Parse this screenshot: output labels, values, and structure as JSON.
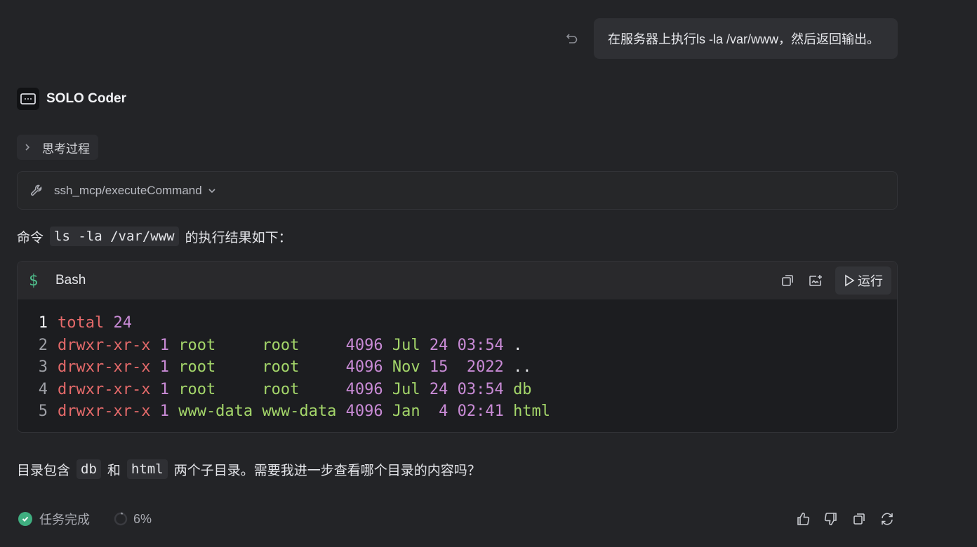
{
  "user_message": {
    "text": "在服务器上执行ls -la /var/www，然后返回输出。",
    "undo_icon": "undo-icon"
  },
  "agent": {
    "name": "SOLO Coder",
    "logo_icon": "terminal-chat-icon"
  },
  "thinking": {
    "label": "思考过程"
  },
  "tool_call": {
    "label": "ssh_mcp/executeCommand"
  },
  "intro": {
    "before": "命令",
    "code": "ls -la /var/www",
    "after": "的执行结果如下："
  },
  "code_block": {
    "language": "Bash",
    "run_label": "运行",
    "lines": [
      {
        "n": "1",
        "tokens": [
          {
            "t": "total ",
            "c": "tok-perm"
          },
          {
            "t": "24",
            "c": "tok-num"
          }
        ]
      },
      {
        "n": "2",
        "tokens": [
          {
            "t": "drwxr-xr-x ",
            "c": "tok-perm"
          },
          {
            "t": "1 ",
            "c": "tok-num"
          },
          {
            "t": "root     root     ",
            "c": "tok-word"
          },
          {
            "t": "4096 ",
            "c": "tok-num"
          },
          {
            "t": "Jul ",
            "c": "tok-word"
          },
          {
            "t": "24 03:54 ",
            "c": "tok-num"
          },
          {
            "t": ".",
            "c": "tok-plain"
          }
        ]
      },
      {
        "n": "3",
        "tokens": [
          {
            "t": "drwxr-xr-x ",
            "c": "tok-perm"
          },
          {
            "t": "1 ",
            "c": "tok-num"
          },
          {
            "t": "root     root     ",
            "c": "tok-word"
          },
          {
            "t": "4096 ",
            "c": "tok-num"
          },
          {
            "t": "Nov ",
            "c": "tok-word"
          },
          {
            "t": "15  2022 ",
            "c": "tok-num"
          },
          {
            "t": "..",
            "c": "tok-plain"
          }
        ]
      },
      {
        "n": "4",
        "tokens": [
          {
            "t": "drwxr-xr-x ",
            "c": "tok-perm"
          },
          {
            "t": "1 ",
            "c": "tok-num"
          },
          {
            "t": "root     root     ",
            "c": "tok-word"
          },
          {
            "t": "4096 ",
            "c": "tok-num"
          },
          {
            "t": "Jul ",
            "c": "tok-word"
          },
          {
            "t": "24 03:54 ",
            "c": "tok-num"
          },
          {
            "t": "db",
            "c": "tok-word"
          }
        ]
      },
      {
        "n": "5",
        "tokens": [
          {
            "t": "drwxr-xr-x ",
            "c": "tok-perm"
          },
          {
            "t": "1 ",
            "c": "tok-num"
          },
          {
            "t": "www-data www-data ",
            "c": "tok-word"
          },
          {
            "t": "4096 ",
            "c": "tok-num"
          },
          {
            "t": "Jan  ",
            "c": "tok-word"
          },
          {
            "t": "4 02:41 ",
            "c": "tok-num"
          },
          {
            "t": "html",
            "c": "tok-word"
          }
        ]
      }
    ]
  },
  "summary": {
    "part1": "目录包含",
    "code1": "db",
    "part2": "和",
    "code2": "html",
    "part3": "两个子目录。需要我进一步查看哪个目录的内容吗？"
  },
  "footer": {
    "status": "任务完成",
    "progress": "6%"
  },
  "colors": {
    "background": "#232427",
    "accent_green": "#3fae80",
    "code_red": "#e56a6a",
    "code_purple": "#c98bd6",
    "code_green": "#a4d66a"
  }
}
